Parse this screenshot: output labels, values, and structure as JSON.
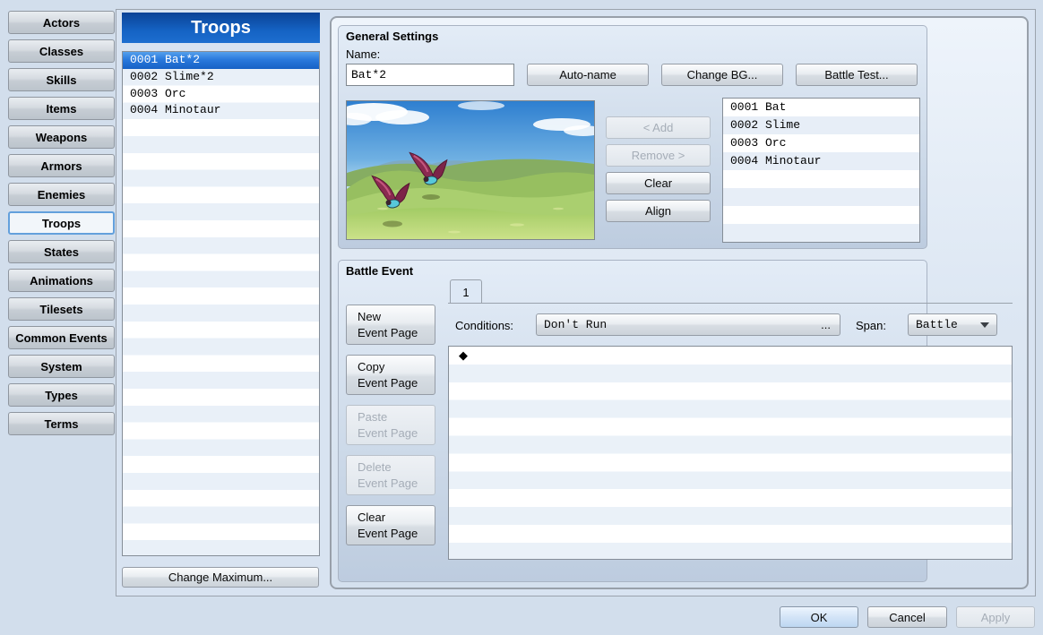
{
  "sidebar": {
    "tabs": [
      "Actors",
      "Classes",
      "Skills",
      "Items",
      "Weapons",
      "Armors",
      "Enemies",
      "Troops",
      "States",
      "Animations",
      "Tilesets",
      "Common Events",
      "System",
      "Types",
      "Terms"
    ],
    "selected_tab": "Troops"
  },
  "troops_panel": {
    "title": "Troops",
    "items": [
      "0001 Bat*2",
      "0002 Slime*2",
      "0003 Orc",
      "0004 Minotaur"
    ],
    "selected_item": "0001 Bat*2",
    "change_maximum_label": "Change Maximum..."
  },
  "general_settings": {
    "title": "General Settings",
    "name_label": "Name:",
    "name_value": "Bat*2",
    "auto_name_label": "Auto-name",
    "change_bg_label": "Change BG...",
    "battle_test_label": "Battle Test...",
    "member_actions": [
      {
        "label": "< Add",
        "disabled": true
      },
      {
        "label": "Remove >",
        "disabled": true
      },
      {
        "label": "Clear",
        "disabled": false
      },
      {
        "label": "Align",
        "disabled": false
      }
    ],
    "members": [
      "0001 Bat",
      "0002 Slime",
      "0003 Orc",
      "0004 Minotaur"
    ]
  },
  "battle_event": {
    "title": "Battle Event",
    "tab_label": "1",
    "page_buttons": [
      {
        "line1": "New",
        "line2": "Event Page",
        "disabled": false
      },
      {
        "line1": "Copy",
        "line2": "Event Page",
        "disabled": false
      },
      {
        "line1": "Paste",
        "line2": "Event Page",
        "disabled": true
      },
      {
        "line1": "Delete",
        "line2": "Event Page",
        "disabled": true
      },
      {
        "line1": "Clear",
        "line2": "Event Page",
        "disabled": false
      }
    ],
    "conditions_label": "Conditions:",
    "conditions_value": "Don't Run",
    "conditions_more": "...",
    "span_label": "Span:",
    "span_value": "Battle",
    "event_marker": "◆"
  },
  "footer": {
    "ok_label": "OK",
    "cancel_label": "Cancel",
    "apply_label": "Apply",
    "apply_disabled": true
  },
  "colors": {
    "page_background": "#d2deec",
    "header_blue_top": "#0a4296",
    "header_blue_bottom": "#1d6ecf",
    "selection_blue": "#2a79dc",
    "alt_row": "#e9f0f8",
    "disabled_text": "#a5adb7"
  }
}
